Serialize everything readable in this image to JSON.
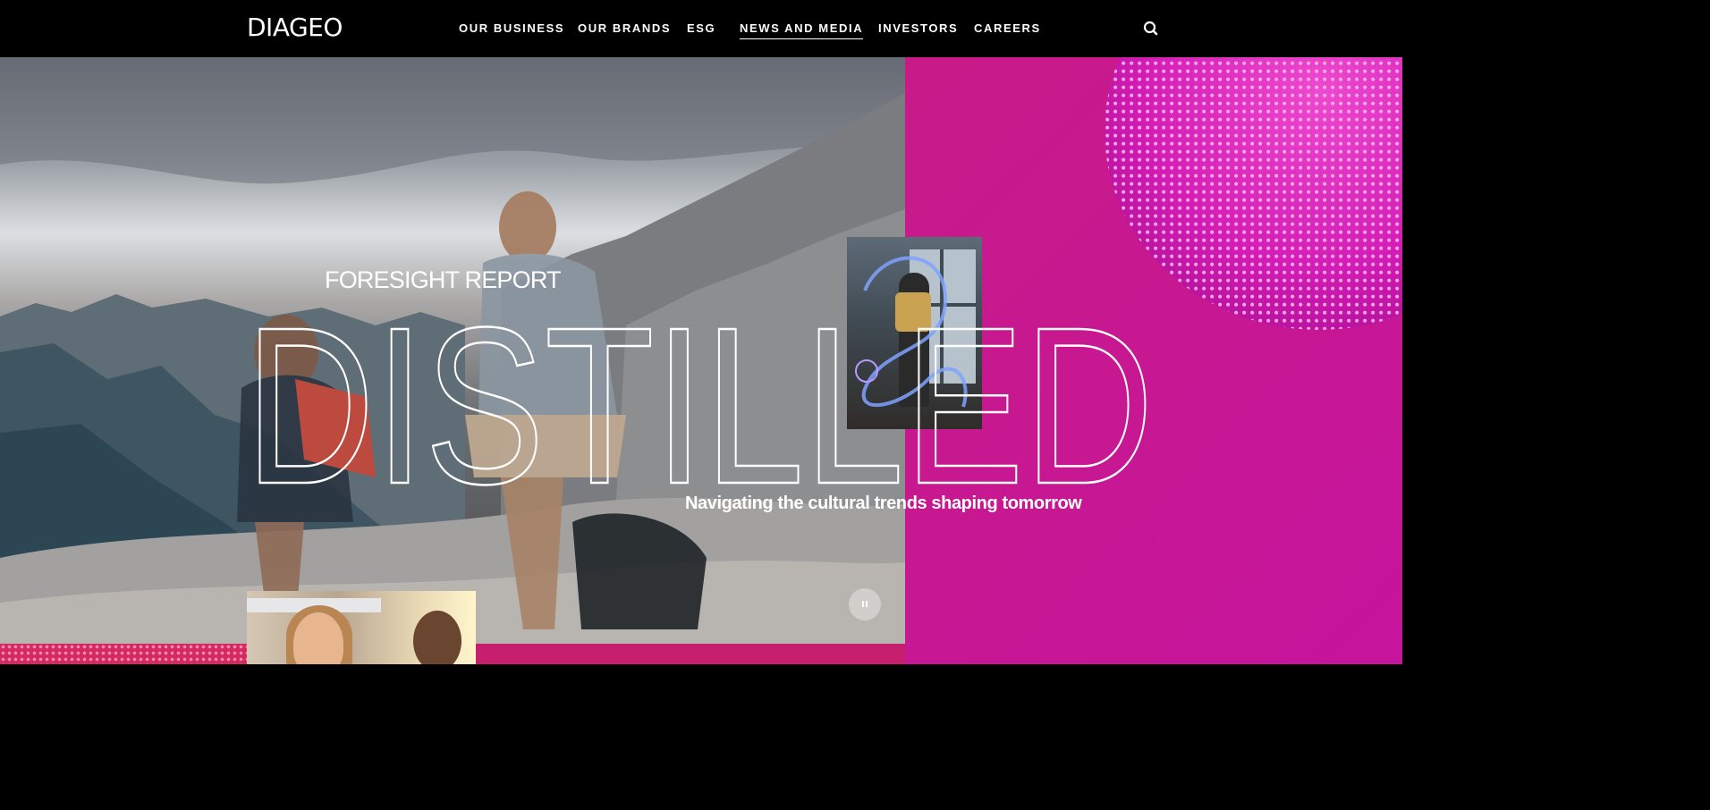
{
  "header": {
    "logo": "DIAGEO",
    "nav": [
      {
        "label": "OUR BUSINESS",
        "active": false
      },
      {
        "label": "OUR BRANDS",
        "active": false
      },
      {
        "label": "ESG",
        "active": false
      },
      {
        "label": "NEWS AND MEDIA",
        "active": true
      },
      {
        "label": "INVESTORS",
        "active": false
      },
      {
        "label": "CAREERS",
        "active": false
      }
    ],
    "search_icon": "search-icon"
  },
  "hero": {
    "eyebrow": "FORESIGHT REPORT",
    "title": "DISTILLED",
    "tagline": "Navigating the cultural trends shaping tomorrow",
    "pause_icon": "pause-icon"
  },
  "colors": {
    "header_bg": "#000000",
    "accent_magenta": "#c8198c",
    "accent_pink": "#c7236a",
    "text": "#ffffff"
  }
}
